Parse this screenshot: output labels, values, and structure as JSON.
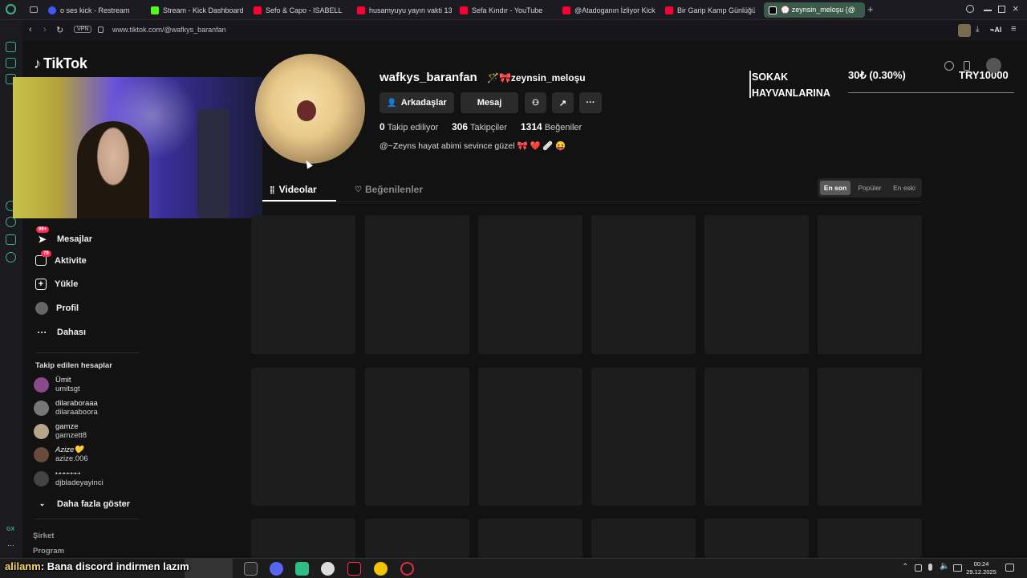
{
  "browser": {
    "tabs": [
      {
        "label": "o ses kick - Restream",
        "color": "#3d5afe"
      },
      {
        "label": "Stream - Kick Dashboard",
        "color": "#53fc18"
      },
      {
        "label": "Sefo & Capo - ISABELL",
        "color": "#ff0000"
      },
      {
        "label": "husamyuyu yayın vakti 13",
        "color": "#ff0000"
      },
      {
        "label": "Sefa Kındır - YouTube",
        "color": "#ff0000"
      },
      {
        "label": "@Atadoganın İzliyor Kick",
        "color": "#ff0000"
      },
      {
        "label": "Bir Garip Kamp Günlüğü /",
        "color": "#ff0000"
      },
      {
        "label": "💮 zeynsin_meloşu (@",
        "color": "#000000"
      }
    ],
    "vpn": "VPN",
    "url": "www.tiktok.com/@wafkys_baranfan",
    "ai_label": "AI"
  },
  "tiktok": {
    "logo": "TikTok",
    "nav": [
      {
        "label": "Mesajlar",
        "badge": "99+",
        "icon": "paper-plane-icon"
      },
      {
        "label": "Aktivite",
        "badge": "79",
        "icon": "inbox-icon"
      },
      {
        "label": "Yükle",
        "icon": "plus-square-icon"
      },
      {
        "label": "Profil",
        "icon": "avatar-icon"
      },
      {
        "label": "Dahası",
        "icon": "ellipsis-icon"
      }
    ],
    "following_title": "Takip edilen hesaplar",
    "following": [
      {
        "name": "Ümit",
        "user": "umitsgt"
      },
      {
        "name": "dilaraboraaa",
        "user": "dilaraaboora"
      },
      {
        "name": "gamze",
        "user": "gamzett8"
      },
      {
        "name": "Azize💛",
        "user": "azize.006"
      },
      {
        "name": "•-•-•-•-•-•-•",
        "user": "djbladeyayinci"
      }
    ],
    "show_more": "Daha fazla göster",
    "footer": [
      "Şirket",
      "Program"
    ]
  },
  "profile": {
    "username": "wafkys_baranfan",
    "nickname": "🪄🎀zeynsin_meloşu",
    "buttons": {
      "friends": "Arkadaşlar",
      "message": "Mesaj"
    },
    "stats": [
      {
        "value": "0",
        "label": "Takip ediliyor"
      },
      {
        "value": "306",
        "label": "Takipçiler"
      },
      {
        "value": "1314",
        "label": "Beğeniler"
      }
    ],
    "bio": "@~Zeyns hayat abimi sevince güzel 🎀 ❤️ 🩹 😝",
    "tabs": {
      "videos": "Videolar",
      "liked": "Beğenilenler"
    },
    "sort": [
      "En son",
      "Popüler",
      "En eski"
    ]
  },
  "overlay": {
    "donation_title": "SOKAK HAYVANLARINA",
    "donation_amount": "30₺ (0.30%)",
    "donation_goal": "TRY10000",
    "chat_user": "alilanm",
    "chat_text": ": Bana discord indirmen lazım"
  },
  "taskbar": {
    "time": "00:24",
    "date": "29.12.2025"
  }
}
